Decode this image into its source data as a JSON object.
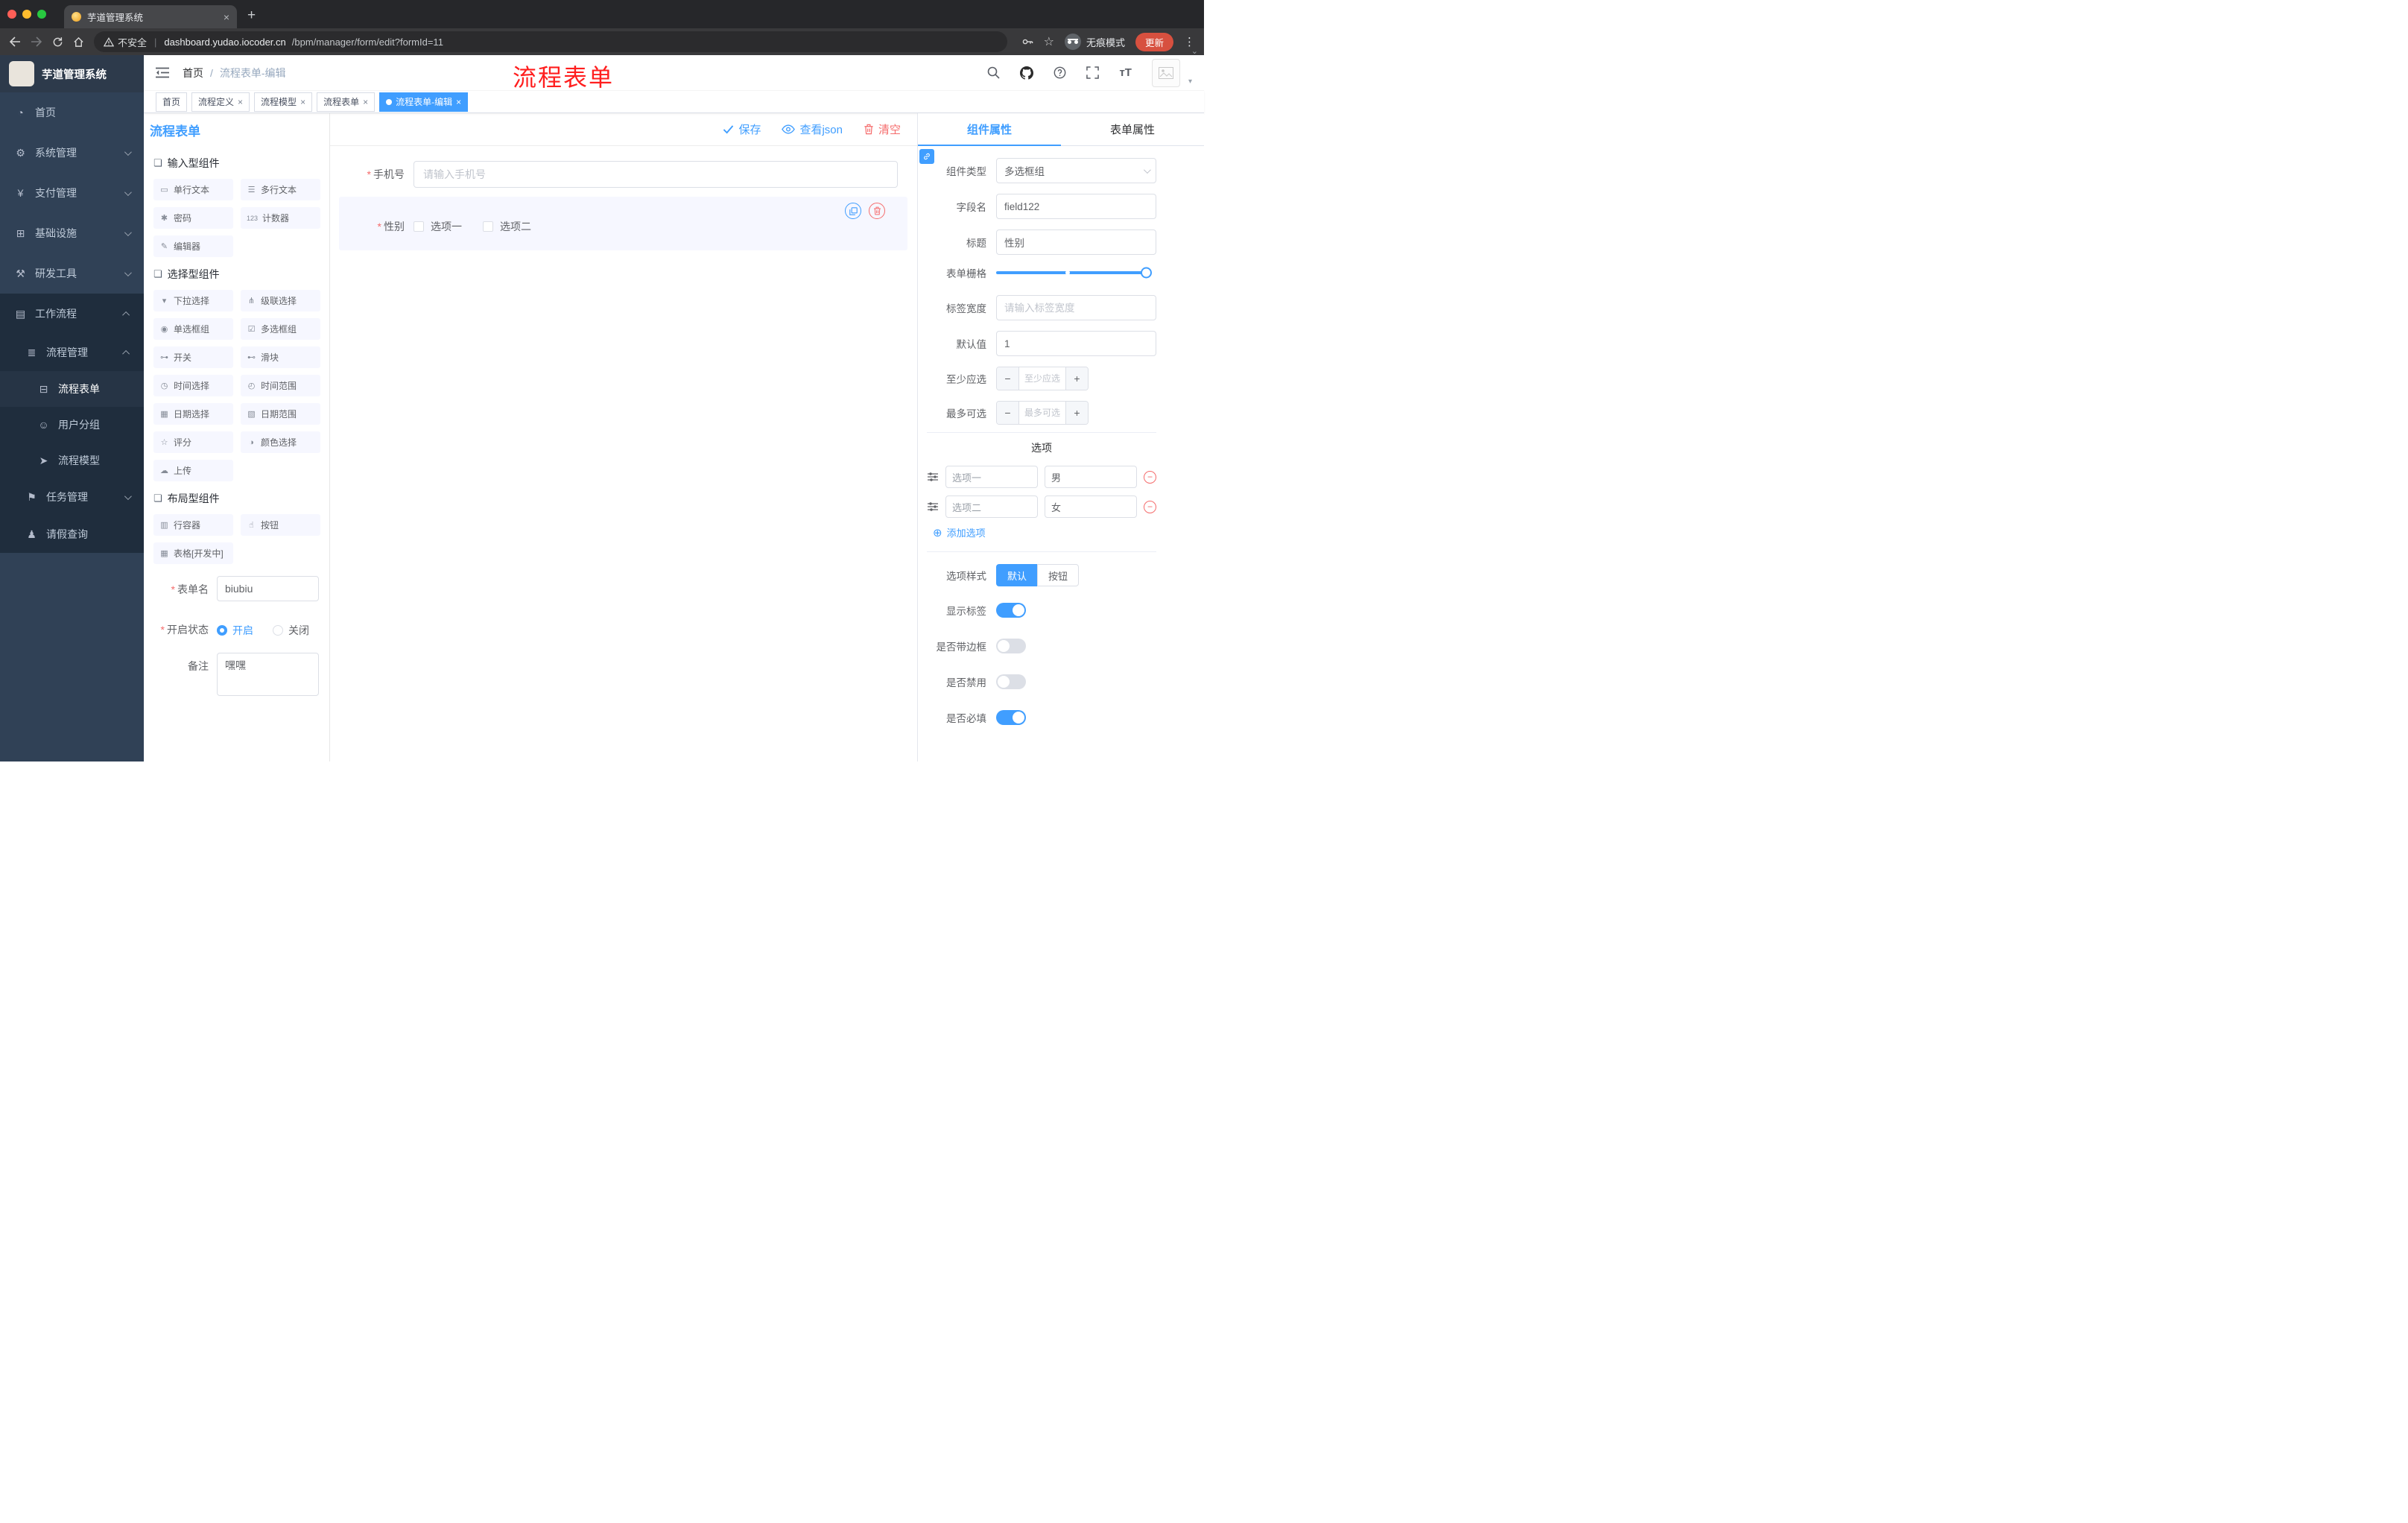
{
  "colors": {
    "accent": "#409EFF",
    "danger": "#F56C6C",
    "sidebar_bg": "#304156",
    "submenu_bg": "#1F2D3D",
    "active_tag_bg": "#409EFF",
    "update_badge": "#D7503F"
  },
  "browser": {
    "tab_title": "芋道管理系统",
    "security_label": "不安全",
    "url_domain": "dashboard.yudao.iocoder.cn",
    "url_path": "/bpm/manager/form/edit?formId=11",
    "incognito_label": "无痕模式",
    "update_label": "更新"
  },
  "sidebar": {
    "logo_title": "芋道管理系统",
    "items": [
      {
        "label": "首页",
        "glyph": "◔"
      },
      {
        "label": "系统管理",
        "glyph": "⚙"
      },
      {
        "label": "支付管理",
        "glyph": "¥"
      },
      {
        "label": "基础设施",
        "glyph": "⊞"
      },
      {
        "label": "研发工具",
        "glyph": "⚒"
      },
      {
        "label": "工作流程",
        "glyph": "▤"
      }
    ],
    "workflow": {
      "process_mgmt": {
        "label": "流程管理",
        "glyph": "≣"
      },
      "process_children": [
        {
          "label": "流程表单",
          "glyph": "⊟"
        },
        {
          "label": "用户分组",
          "glyph": "☺"
        },
        {
          "label": "流程模型",
          "glyph": "➤"
        }
      ],
      "task_mgmt": {
        "label": "任务管理",
        "glyph": "⚑"
      },
      "leave_query": {
        "label": "请假查询",
        "glyph": "♟"
      }
    }
  },
  "header": {
    "breadcrumb_home": "首页",
    "breadcrumb_sep": "/",
    "breadcrumb_current": "流程表单-编辑",
    "watermark": "流程表单"
  },
  "tags": [
    {
      "label": "首页"
    },
    {
      "label": "流程定义"
    },
    {
      "label": "流程模型"
    },
    {
      "label": "流程表单"
    },
    {
      "label": "流程表单-编辑"
    }
  ],
  "designer": {
    "panel_title": "流程表单",
    "toolbar": {
      "save": "保存",
      "view_json": "查看json",
      "clear": "清空"
    },
    "groups": [
      {
        "title": "输入型组件",
        "icon": "❏",
        "items": [
          {
            "label": "单行文本",
            "glyph": "▭"
          },
          {
            "label": "多行文本",
            "glyph": "☰"
          },
          {
            "label": "密码",
            "glyph": "✱"
          },
          {
            "label": "计数器",
            "glyph": "123"
          },
          {
            "label": "编辑器",
            "glyph": "✎"
          }
        ]
      },
      {
        "title": "选择型组件",
        "icon": "❏",
        "items": [
          {
            "label": "下拉选择",
            "glyph": "▾"
          },
          {
            "label": "级联选择",
            "glyph": "⋔"
          },
          {
            "label": "单选框组",
            "glyph": "◉"
          },
          {
            "label": "多选框组",
            "glyph": "☑"
          },
          {
            "label": "开关",
            "glyph": "⊶"
          },
          {
            "label": "滑块",
            "glyph": "⊷"
          },
          {
            "label": "时间选择",
            "glyph": "◷"
          },
          {
            "label": "时间范围",
            "glyph": "◴"
          },
          {
            "label": "日期选择",
            "glyph": "▦"
          },
          {
            "label": "日期范围",
            "glyph": "▧"
          },
          {
            "label": "评分",
            "glyph": "☆"
          },
          {
            "label": "颜色选择",
            "glyph": "◑"
          },
          {
            "label": "上传",
            "glyph": "☁"
          }
        ]
      },
      {
        "title": "布局型组件",
        "icon": "❏",
        "items": [
          {
            "label": "行容器",
            "glyph": "▥"
          },
          {
            "label": "按钮",
            "glyph": "☝"
          },
          {
            "label": "表格[开发中]",
            "glyph": "▦"
          }
        ]
      }
    ],
    "form_meta": {
      "name_label": "表单名",
      "name_value": "biubiu",
      "status_label": "开启状态",
      "status_on": "开启",
      "status_off": "关闭",
      "remark_label": "备注",
      "remark_value": "嘿嘿"
    },
    "canvas": {
      "phone_label": "手机号",
      "phone_placeholder": "请输入手机号",
      "gender_label": "性别",
      "gender_options": [
        {
          "label": "选项一"
        },
        {
          "label": "选项二"
        }
      ]
    }
  },
  "props": {
    "tab_component": "组件属性",
    "tab_form": "表单属性",
    "component_type_label": "组件类型",
    "component_type_value": "多选框组",
    "field_name_label": "字段名",
    "field_name_value": "field122",
    "title_label": "标题",
    "title_value": "性别",
    "grid_label": "表单栅格",
    "label_width_label": "标签宽度",
    "label_width_placeholder": "请输入标签宽度",
    "default_label": "默认值",
    "default_value": "1",
    "min_label": "至少应选",
    "min_placeholder": "至少应选",
    "max_label": "最多可选",
    "max_placeholder": "最多可选",
    "options_title": "选项",
    "options": [
      {
        "name": "选项一",
        "value": "男"
      },
      {
        "name": "选项二",
        "value": "女"
      }
    ],
    "add_option_label": "添加选项",
    "option_style_label": "选项样式",
    "style_default": "默认",
    "style_button": "按钮",
    "toggles": [
      {
        "label": "显示标签",
        "on": true
      },
      {
        "label": "是否带边框",
        "on": false
      },
      {
        "label": "是否禁用",
        "on": false
      },
      {
        "label": "是否必填",
        "on": true
      }
    ]
  }
}
